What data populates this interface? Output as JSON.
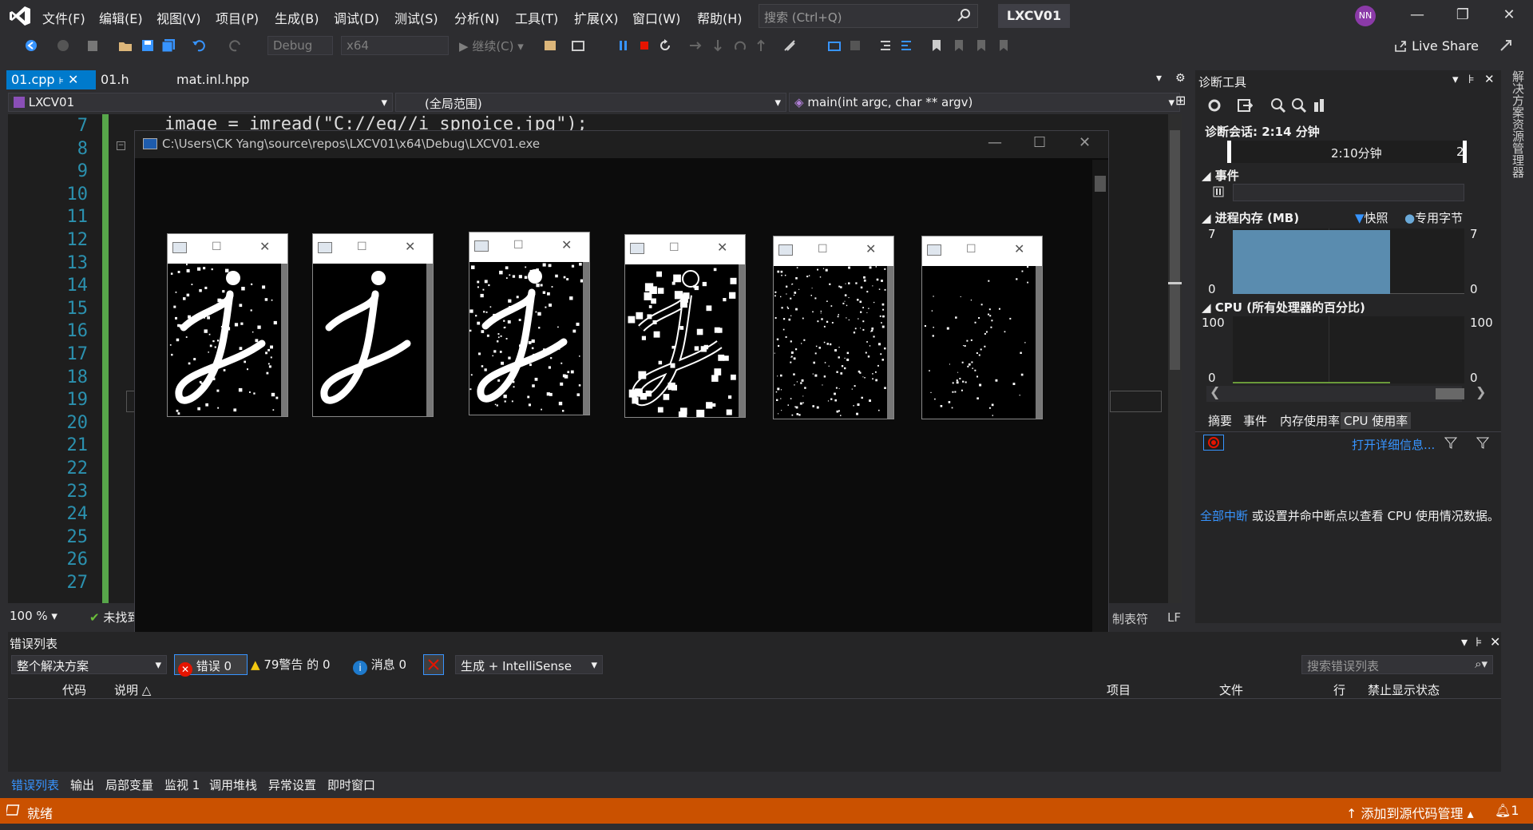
{
  "menu": [
    "文件(F)",
    "编辑(E)",
    "视图(V)",
    "项目(P)",
    "生成(B)",
    "调试(D)",
    "测试(S)",
    "分析(N)",
    "工具(T)",
    "扩展(X)",
    "窗口(W)",
    "帮助(H)"
  ],
  "search": {
    "placeholder": "搜索 (Ctrl+Q)"
  },
  "project_name": "LXCV01",
  "user_initials": "NN",
  "toolbar": {
    "config": "Debug",
    "platform": "x64",
    "continue": "继续(C)",
    "live_share": "Live Share"
  },
  "editor_tabs": [
    {
      "label": "01.cpp",
      "active": true
    },
    {
      "label": "01.h"
    },
    {
      "label": "mat.inl.hpp"
    }
  ],
  "navbar": {
    "project": "LXCV01",
    "scope": "(全局范围)",
    "function": "main(int argc, char ** argv)"
  },
  "editor": {
    "line_numbers": [
      "7",
      "8",
      "9",
      "10",
      "11",
      "12",
      "13",
      "14",
      "15",
      "16",
      "17",
      "18",
      "19",
      "20",
      "21",
      "22",
      "23",
      "24",
      "25",
      "26",
      "27"
    ],
    "code_line": "image = imread(\"C://eg//i_spnoice.jpg\");",
    "zoom": "100 %",
    "issues": "未找到",
    "line_end": "LF",
    "tabs_label": "制表符"
  },
  "console": {
    "title": "C:\\Users\\CK Yang\\source\\repos\\LXCV01\\x64\\Debug\\LXCV01.exe"
  },
  "diag": {
    "title": "诊断工具",
    "session": "诊断会话: 2:14 分钟",
    "timeline_label": "2:10分钟",
    "timeline_right": "2",
    "events": "事件",
    "memory": "进程内存 (MB)",
    "legend_snapshot": "快照",
    "legend_private": "专用字节",
    "mem_max": "7",
    "mem_min": "0",
    "cpu": "CPU (所有处理器的百分比)",
    "cpu_max": "100",
    "cpu_min": "0",
    "tabs": [
      "摘要",
      "事件",
      "内存使用率",
      "CPU 使用率"
    ],
    "open_details": "打开详细信息...",
    "hint_link": "全部中断",
    "hint_text": "或设置并命中断点以查看 CPU 使用情况数据。"
  },
  "side_tab": "解决方案资源管理器",
  "errors": {
    "title": "错误列表",
    "scope": "整个解决方案",
    "errors": "错误 0",
    "warnings": "79警告 的 0",
    "messages": "消息 0",
    "build_filter": "生成 + IntelliSense",
    "search_placeholder": "搜索错误列表",
    "columns": [
      "代码",
      "说明",
      "项目",
      "文件",
      "行",
      "禁止显示状态"
    ]
  },
  "bottom_tabs": [
    "错误列表",
    "输出",
    "局部变量",
    "监视 1",
    "调用堆栈",
    "异常设置",
    "即时窗口"
  ],
  "status": {
    "ready": "就绪",
    "source_control": "添加到源代码管理",
    "notifications": "1"
  },
  "colors": {
    "accent": "#007acc",
    "status": "#ca5100",
    "background": "#2d2d30"
  }
}
